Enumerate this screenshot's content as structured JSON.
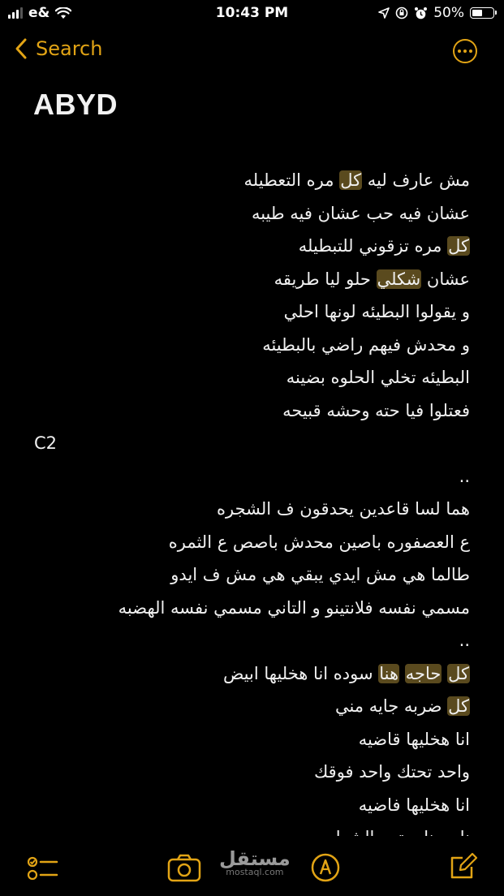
{
  "status": {
    "carrier": "e&",
    "time": "10:43 PM",
    "battery_text": "50%",
    "battery_level": 0.5
  },
  "nav": {
    "back_label": "Search",
    "more_icon": "ellipsis-circle-icon"
  },
  "note": {
    "title": "ABYD",
    "lines": [
      {
        "dir": "rtl",
        "segments": [
          {
            "t": "مش عارف ليه "
          },
          {
            "t": "كل",
            "hl": true
          },
          {
            "t": " مره التعطيله"
          }
        ]
      },
      {
        "dir": "rtl",
        "segments": [
          {
            "t": "عشان فيه حب عشان فيه طيبه"
          }
        ]
      },
      {
        "dir": "rtl",
        "segments": [
          {
            "t": "كل",
            "hl": true
          },
          {
            "t": " مره تزقوني للتبطيله"
          }
        ]
      },
      {
        "dir": "rtl",
        "segments": [
          {
            "t": "عشان "
          },
          {
            "t": "شكلي",
            "hl": true
          },
          {
            "t": " حلو ليا طريقه"
          }
        ]
      },
      {
        "dir": "rtl",
        "segments": [
          {
            "t": "و يقولوا البطيئه لونها احلي"
          }
        ]
      },
      {
        "dir": "rtl",
        "segments": [
          {
            "t": "و محدش فيهم راضي بالبطيئه"
          }
        ]
      },
      {
        "dir": "rtl",
        "segments": [
          {
            "t": "البطيئه تخلي الحلوه بضينه"
          }
        ]
      },
      {
        "dir": "rtl",
        "segments": [
          {
            "t": "فعتلوا فيا حته وحشه قبيحه"
          }
        ]
      },
      {
        "dir": "ltr",
        "segments": [
          {
            "t": "C2"
          }
        ]
      },
      {
        "dir": "rtl",
        "segments": [
          {
            "t": ".."
          }
        ]
      },
      {
        "dir": "rtl",
        "segments": [
          {
            "t": "هما لسا قاعدين يحدقون ف الشجره"
          }
        ]
      },
      {
        "dir": "rtl",
        "segments": [
          {
            "t": "ع العصفوره باصين محدش باصص ع الثمره"
          }
        ]
      },
      {
        "dir": "rtl",
        "segments": [
          {
            "t": "طالما هي مش ايدي يبقي هي مش ف ايدو"
          }
        ]
      },
      {
        "dir": "rtl",
        "segments": [
          {
            "t": "مسمي نفسه فلانتينو و التاني مسمي نفسه الهضبه"
          }
        ]
      },
      {
        "dir": "rtl",
        "segments": [
          {
            "t": ".."
          }
        ]
      },
      {
        "dir": "rtl",
        "segments": [
          {
            "t": "كل",
            "hl": true
          },
          {
            "t": " "
          },
          {
            "t": "حاجه",
            "hl": true
          },
          {
            "t": " "
          },
          {
            "t": "هنا",
            "hl": true
          },
          {
            "t": " سوده انا هخليها ابيض"
          }
        ]
      },
      {
        "dir": "rtl",
        "segments": [
          {
            "t": "كل",
            "hl": true
          },
          {
            "t": " ضربه جايه مني"
          }
        ]
      },
      {
        "dir": "rtl",
        "segments": [
          {
            "t": "انا هخليها قاضيه"
          }
        ]
      },
      {
        "dir": "rtl",
        "segments": [
          {
            "t": "واحد تحتك واحد فوقك"
          }
        ]
      },
      {
        "dir": "rtl",
        "segments": [
          {
            "t": "انا هخليها فاضيه"
          }
        ]
      },
      {
        "dir": "rtl",
        "segments": [
          {
            "t": "ناس ناصبتهم الشط"
          }
        ]
      }
    ]
  },
  "toolbar": {
    "checklist_icon": "checklist-icon",
    "camera_icon": "camera-icon",
    "markup_icon": "markup-pen-icon",
    "compose_icon": "compose-icon"
  },
  "watermark": {
    "arabic": "مستقل",
    "latin": "mostaql.com"
  },
  "colors": {
    "accent": "#e2a415",
    "highlight": "#5a4a1e",
    "background": "#000000"
  }
}
